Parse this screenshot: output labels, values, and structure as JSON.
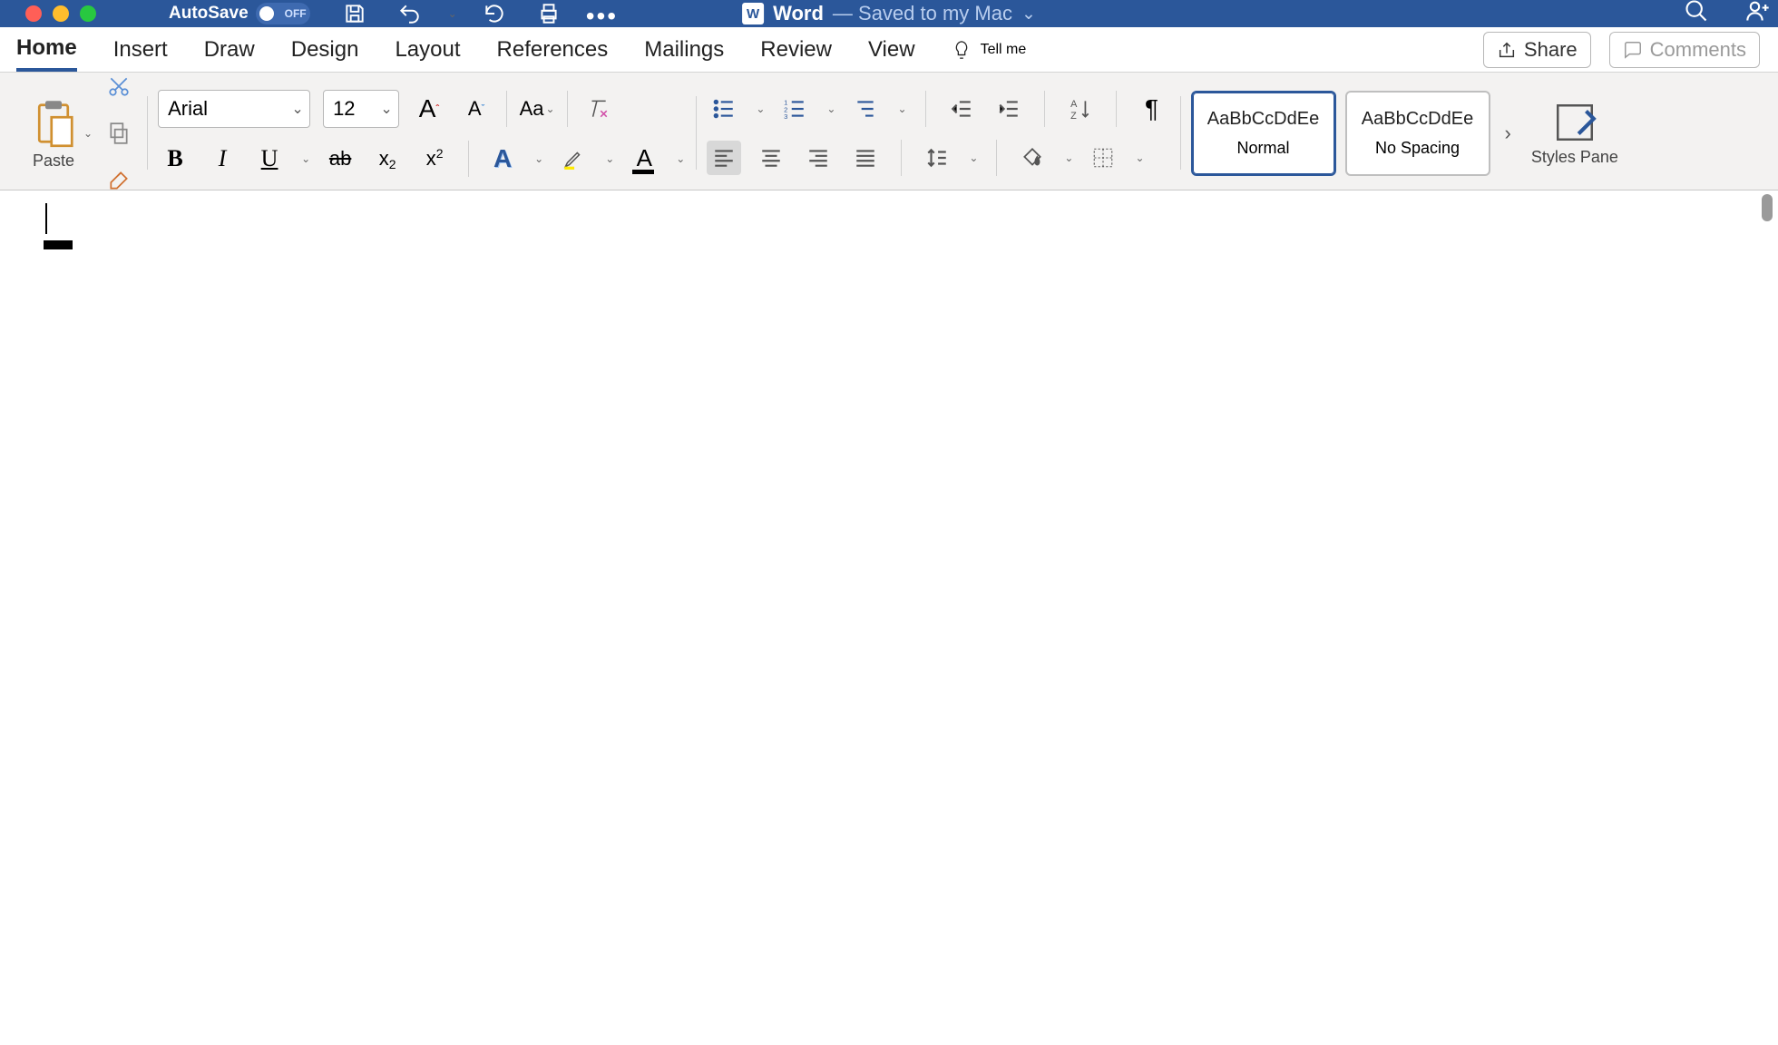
{
  "titlebar": {
    "autosave_label": "AutoSave",
    "autosave_state": "OFF",
    "app_name": "Word",
    "save_status": "— Saved to my Mac"
  },
  "tabs": {
    "items": [
      "Home",
      "Insert",
      "Draw",
      "Design",
      "Layout",
      "References",
      "Mailings",
      "Review",
      "View"
    ],
    "tellme": "Tell me",
    "share": "Share",
    "comments": "Comments"
  },
  "ribbon": {
    "paste": "Paste",
    "font_name": "Arial",
    "font_size": "12",
    "change_case": "Aa",
    "styles": [
      {
        "sample": "AaBbCcDdEe",
        "name": "Normal"
      },
      {
        "sample": "AaBbCcDdEe",
        "name": "No Spacing"
      }
    ],
    "styles_pane": "Styles Pane"
  }
}
